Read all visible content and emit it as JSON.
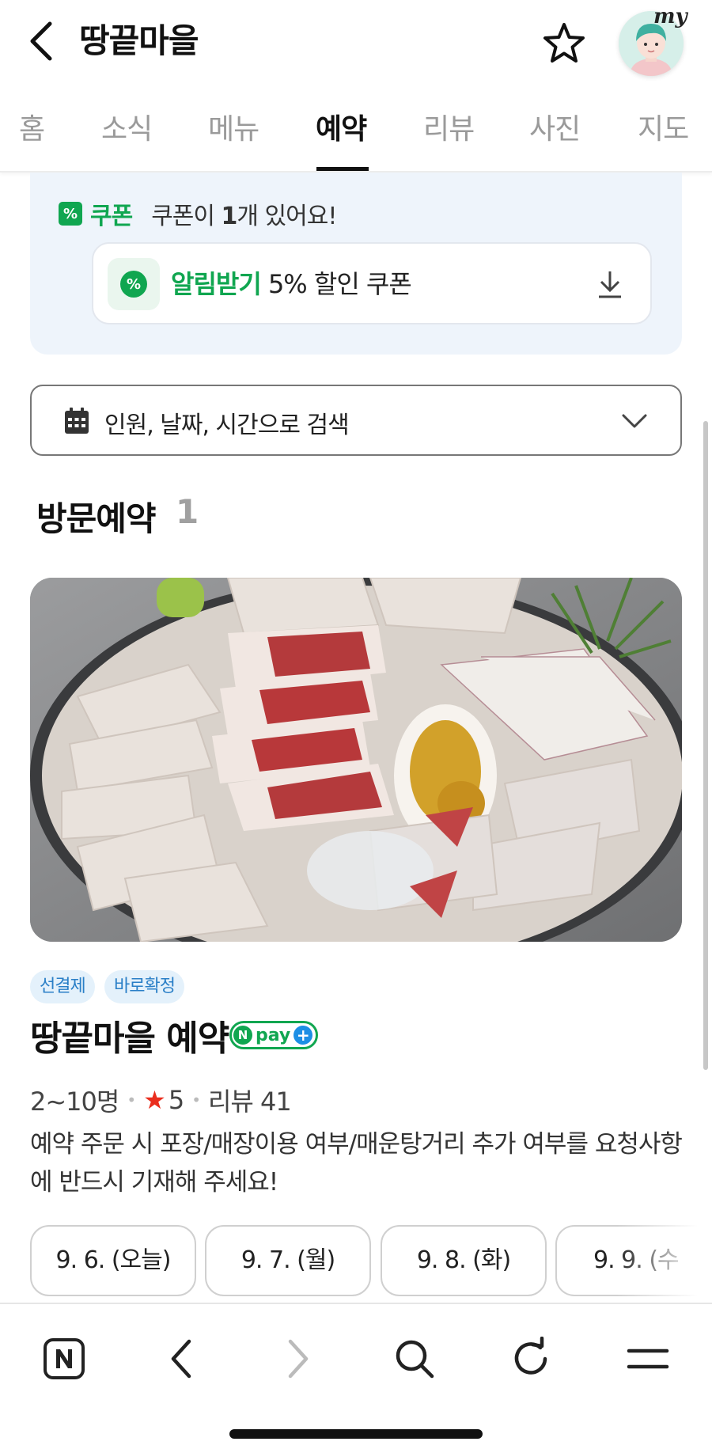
{
  "header": {
    "title": "땅끝마을",
    "avatar_text": "my"
  },
  "tabs": [
    {
      "label": "홈"
    },
    {
      "label": "소식"
    },
    {
      "label": "메뉴"
    },
    {
      "label": "예약"
    },
    {
      "label": "리뷰"
    },
    {
      "label": "사진"
    },
    {
      "label": "지도"
    }
  ],
  "active_tab": "예약",
  "coupon": {
    "label": "쿠폰",
    "summary_prefix": "쿠폰이 ",
    "summary_count": "1",
    "summary_suffix": "개 있어요!",
    "card_highlight": "알림받기",
    "card_text": " 5% 할인 쿠폰",
    "icon_symbol": "%"
  },
  "search": {
    "placeholder": "인원, 날짜, 시간으로 검색"
  },
  "section": {
    "title": "방문예약",
    "count": "1"
  },
  "listing": {
    "badges": [
      "선결제",
      "바로확정"
    ],
    "name": "땅끝마을 예약",
    "npay": {
      "n": "N",
      "pay": "pay",
      "plus": "+"
    },
    "capacity": "2~10명",
    "rating": "5",
    "reviews": "리뷰 41",
    "description": "예약 주문 시 포장/매장이용 여부/매운탕거리 추가 여부를 요청사항에 반드시 기재해 주세요!"
  },
  "dates": [
    {
      "label": "9. 6. (오늘)"
    },
    {
      "label": "9. 7. (월)"
    },
    {
      "label": "9. 8. (화)"
    },
    {
      "label": "9. 9. (수"
    }
  ],
  "colors": {
    "brand_green": "#10a650",
    "badge_blue": "#2a7fc7",
    "star_red": "#ea2e1e",
    "coupon_bg": "#eef4fb"
  },
  "icons": {
    "back": "chevron-left-icon",
    "favorite": "star-outline-icon",
    "download": "download-icon",
    "calendar": "calendar-icon",
    "dropdown": "chevron-down-icon",
    "naver": "naver-n-icon",
    "nav_back": "chevron-left-icon",
    "nav_forward": "chevron-right-icon",
    "search": "search-icon",
    "refresh": "refresh-icon",
    "menu": "hamburger-icon"
  }
}
